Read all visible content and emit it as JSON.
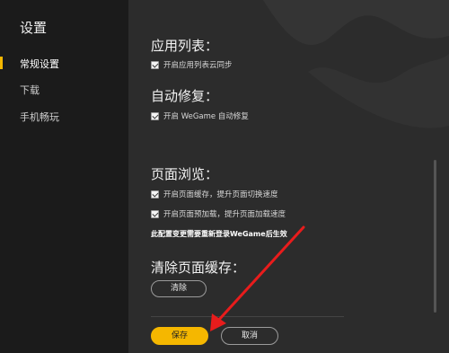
{
  "sidebar": {
    "title": "设置",
    "items": [
      {
        "label": "常规设置",
        "active": true
      },
      {
        "label": "下载",
        "active": false
      },
      {
        "label": "手机畅玩",
        "active": false
      }
    ]
  },
  "sections": {
    "app_list": {
      "title": "应用列表：",
      "option": "开启应用列表云同步",
      "checked": true
    },
    "auto_repair": {
      "title": "自动修复：",
      "option": "开启 WeGame 自动修复",
      "checked": true
    },
    "browse": {
      "title": "页面浏览：",
      "options": [
        {
          "label": "开启页面缓存，提升页面切换速度",
          "checked": true
        },
        {
          "label": "开启页面预加载，提升页面加载速度",
          "checked": true
        }
      ],
      "note": "此配置变更需要重新登录WeGame后生效"
    },
    "cache": {
      "title": "清除页面缓存：",
      "clear_button": "清除"
    }
  },
  "footer": {
    "save_button": "保存",
    "cancel_button": "取消"
  },
  "colors": {
    "accent": "#f5b700",
    "annotation_arrow": "#e81c1c"
  }
}
